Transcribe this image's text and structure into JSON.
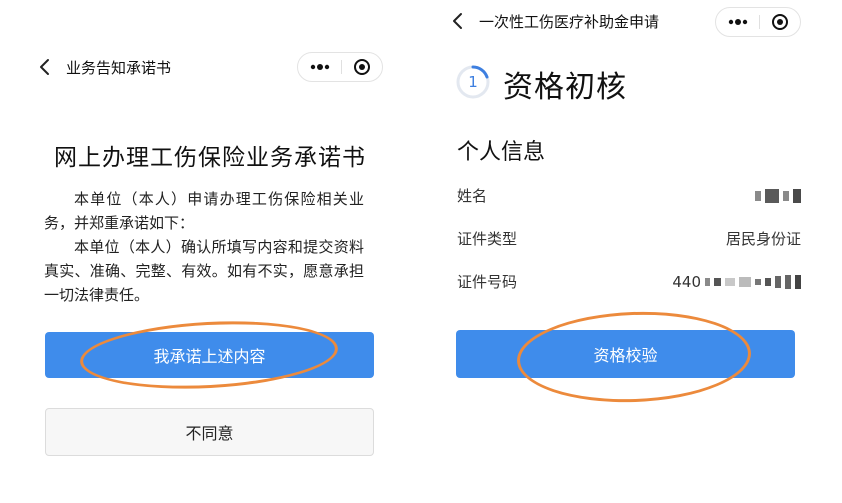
{
  "left_screen": {
    "nav": {
      "title": "业务告知承诺书"
    },
    "document": {
      "title": "网上办理工伤保险业务承诺书",
      "paragraph1": "本单位（本人）申请办理工伤保险相关业务，并郑重承诺如下：",
      "paragraph2": "本单位（本人）确认所填写内容和提交资料真实、准确、完整、有效。如有不实，愿意承担一切法律责任。"
    },
    "buttons": {
      "agree": "我承诺上述内容",
      "disagree": "不同意"
    }
  },
  "right_screen": {
    "nav": {
      "title": "一次性工伤医疗补助金申请"
    },
    "step": {
      "number": "1",
      "title": "资格初核"
    },
    "section_title": "个人信息",
    "rows": [
      {
        "label": "姓名",
        "value": ""
      },
      {
        "label": "证件类型",
        "value": "居民身份证"
      },
      {
        "label": "证件号码",
        "value": "440"
      }
    ],
    "buttons": {
      "verify": "资格校验"
    }
  },
  "colors": {
    "primary_button": "#3f8ceb",
    "highlight_ellipse": "#ec8a3c",
    "step_ring": "#3d7fe0"
  },
  "icons": [
    "back-arrow-icon",
    "more-dots-icon",
    "close-target-icon",
    "step-progress-icon"
  ]
}
